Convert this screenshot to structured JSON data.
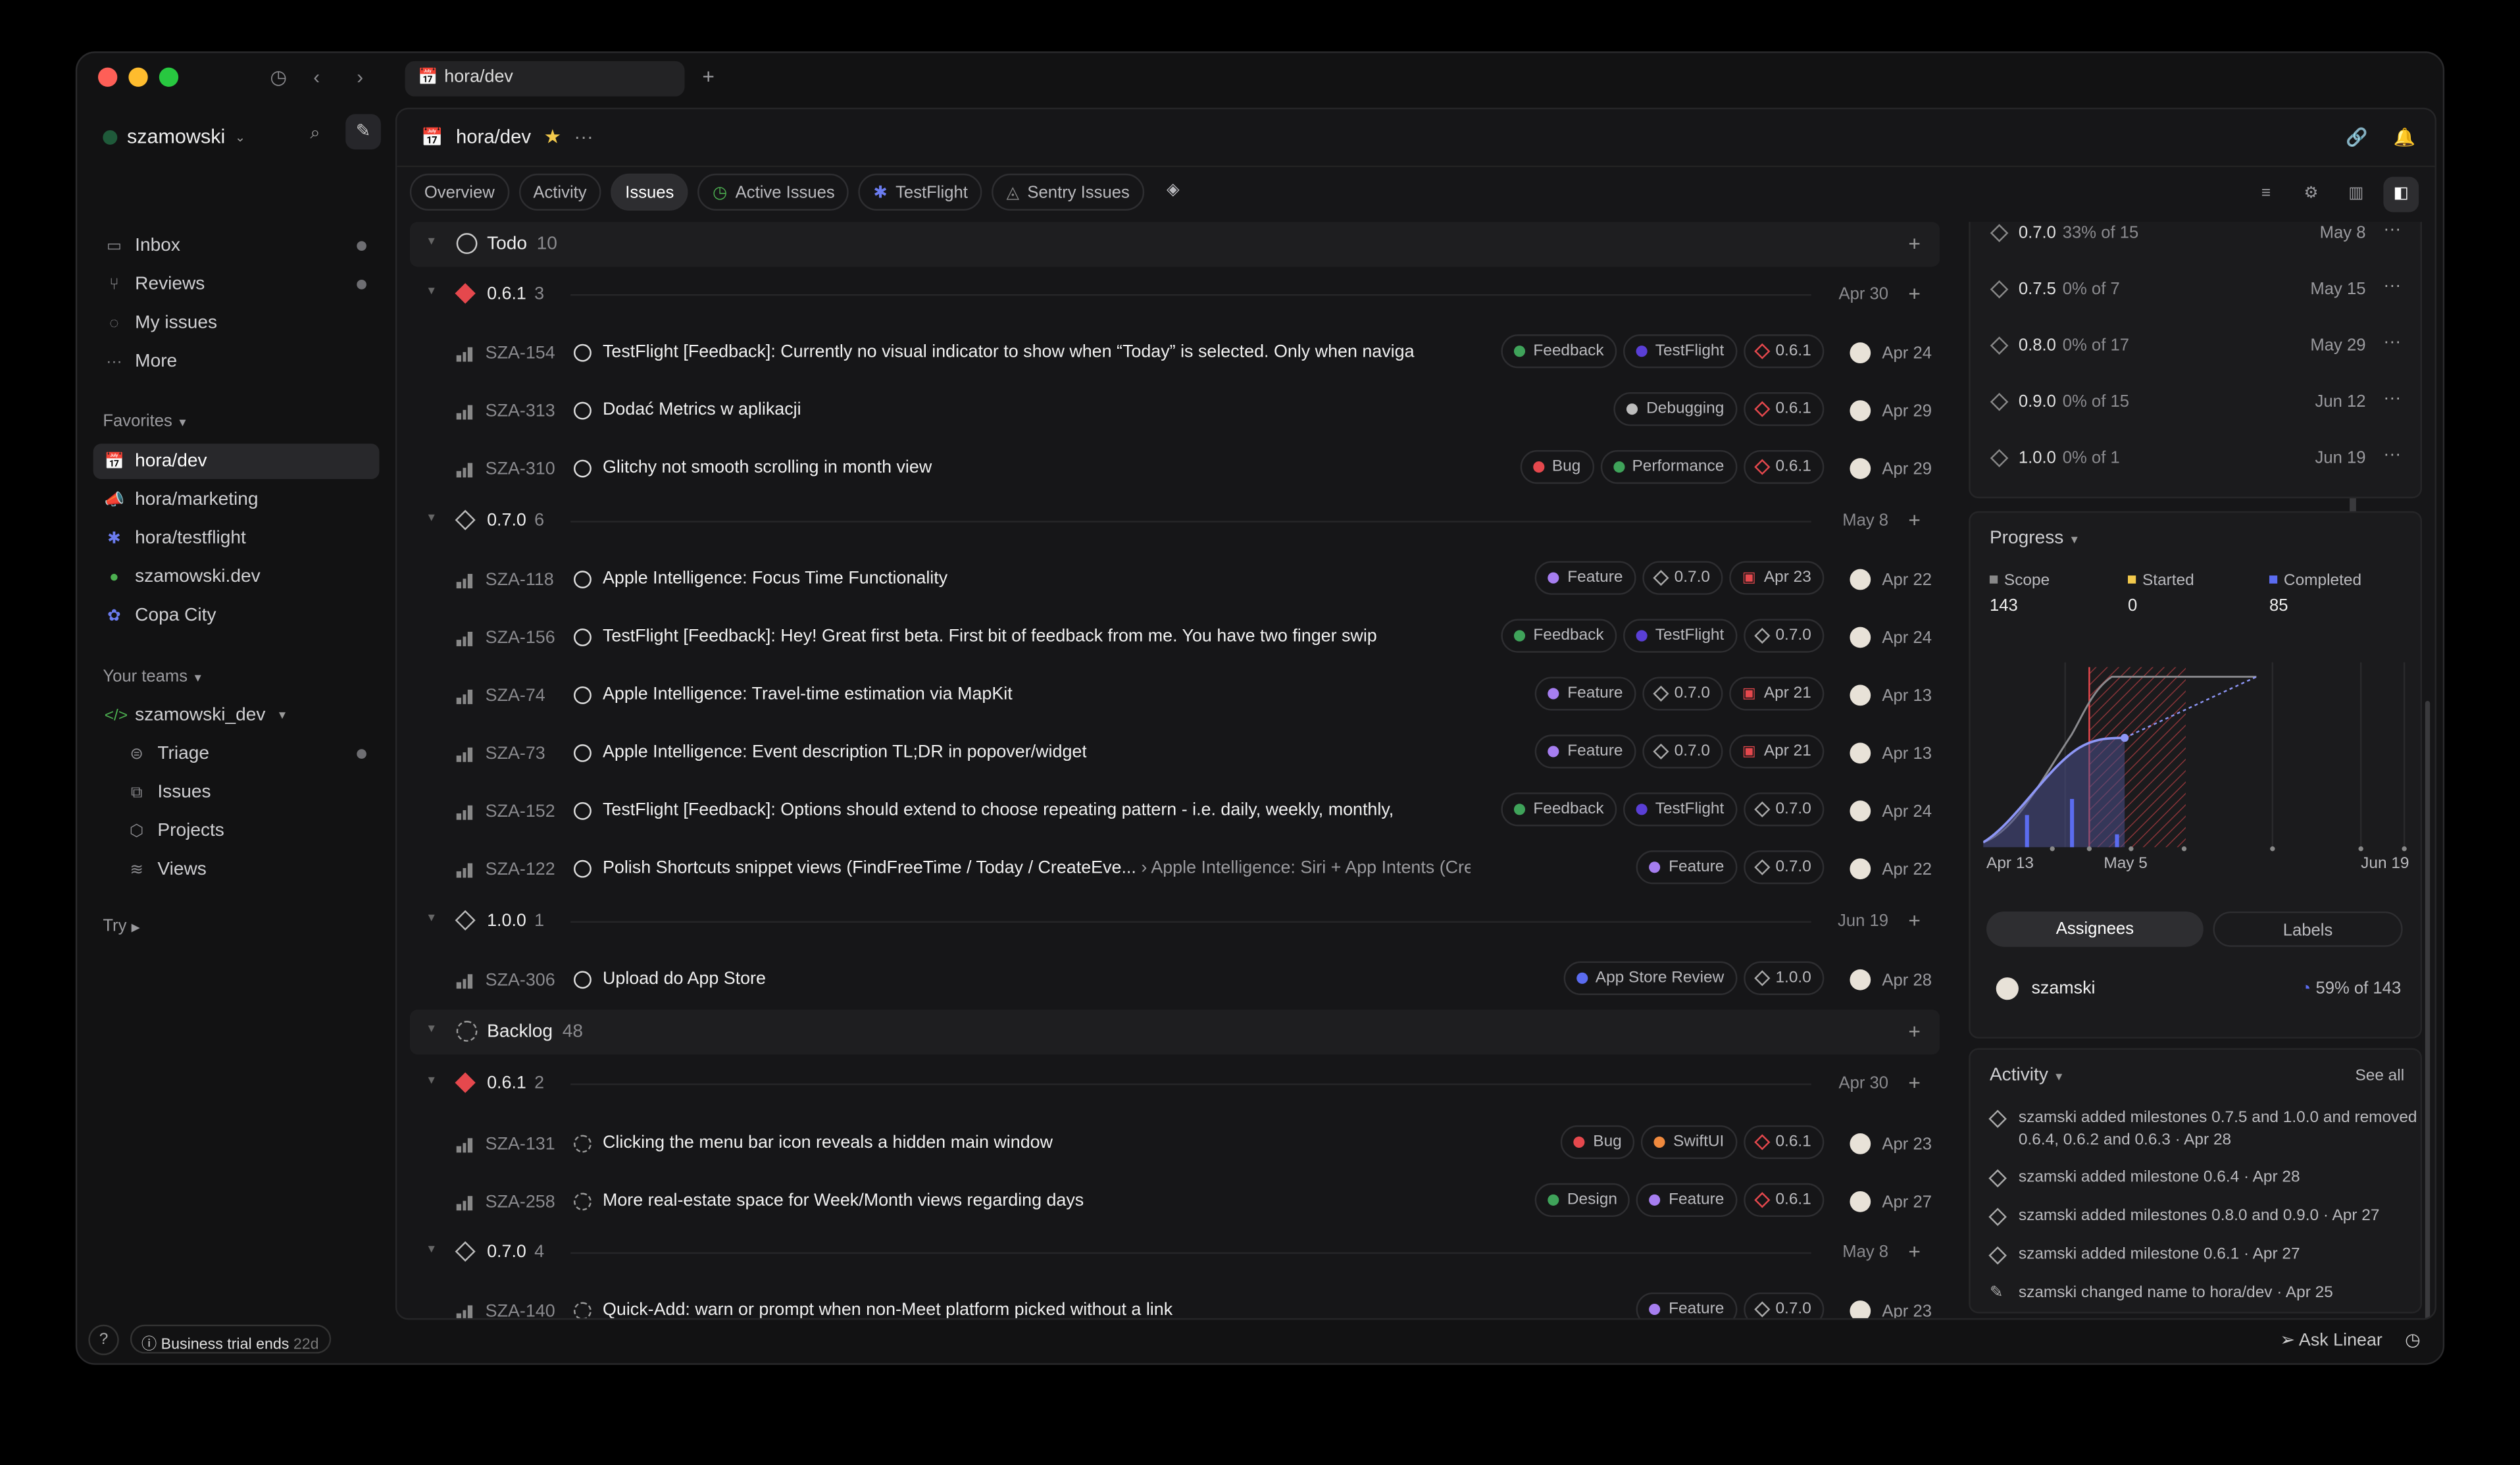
{
  "window": {
    "tab_title": "hora/dev",
    "new_tab": "+"
  },
  "sidebar": {
    "workspace": "szamowski",
    "nav": [
      {
        "label": "Inbox"
      },
      {
        "label": "Reviews"
      },
      {
        "label": "My issues"
      },
      {
        "label": "More"
      }
    ],
    "favorites_label": "Favorites",
    "favorites": [
      {
        "label": "hora/dev"
      },
      {
        "label": "hora/marketing"
      },
      {
        "label": "hora/testflight"
      },
      {
        "label": "szamowski.dev"
      },
      {
        "label": "Copa City"
      }
    ],
    "teams_label": "Your teams",
    "team": "szamowski_dev",
    "team_items": [
      {
        "label": "Triage"
      },
      {
        "label": "Issues"
      },
      {
        "label": "Projects"
      },
      {
        "label": "Views"
      }
    ],
    "try_label": "Try",
    "help": "?",
    "trial": "Business trial ends",
    "trial_days": "22d"
  },
  "header": {
    "title": "hora/dev",
    "more": "···"
  },
  "views": [
    {
      "label": "Overview"
    },
    {
      "label": "Activity"
    },
    {
      "label": "Issues"
    },
    {
      "label": "Active Issues"
    },
    {
      "label": "TestFlight"
    },
    {
      "label": "Sentry Issues"
    }
  ],
  "groups": [
    {
      "name": "Todo",
      "count": "10"
    },
    {
      "name": "Backlog",
      "count": "48"
    }
  ],
  "milestones": [
    {
      "name": "0.6.1",
      "count": "3",
      "date": "Apr 30"
    },
    {
      "name": "0.7.0",
      "count": "6",
      "date": "May 8"
    },
    {
      "name": "1.0.0",
      "count": "1",
      "date": "Jun 19"
    },
    {
      "name": "0.6.1",
      "count": "2",
      "date": "Apr 30"
    },
    {
      "name": "0.7.0",
      "count": "4",
      "date": "May 8"
    }
  ],
  "issues": [
    {
      "id": "SZA-154",
      "title": "TestFlight [Feedback]: Currently no visual indicator to show when “Today” is selected. Only when naviga",
      "labels": [
        "Feedback",
        "TestFlight"
      ],
      "ms": "0.6.1",
      "date": "Apr 24"
    },
    {
      "id": "SZA-313",
      "title": "Dodać Metrics w aplikacji",
      "labels": [
        "Debugging"
      ],
      "ms": "0.6.1",
      "date": "Apr 29"
    },
    {
      "id": "SZA-310",
      "title": "Glitchy not smooth scrolling in month view",
      "labels": [
        "Bug",
        "Performance"
      ],
      "ms": "0.6.1",
      "date": "Apr 29"
    },
    {
      "id": "SZA-118",
      "title": "Apple Intelligence: Focus Time Functionality",
      "labels": [
        "Feature"
      ],
      "ms": "0.7.0",
      "due": "Apr 23",
      "date": "Apr 22"
    },
    {
      "id": "SZA-156",
      "title": "TestFlight [Feedback]: Hey! Great first beta. First bit of feedback from me. You have two finger swip",
      "labels": [
        "Feedback",
        "TestFlight"
      ],
      "ms": "0.7.0",
      "date": "Apr 24"
    },
    {
      "id": "SZA-74",
      "title": "Apple Intelligence: Travel-time estimation via MapKit",
      "labels": [
        "Feature"
      ],
      "ms": "0.7.0",
      "due": "Apr 21",
      "date": "Apr 13"
    },
    {
      "id": "SZA-73",
      "title": "Apple Intelligence: Event description TL;DR in popover/widget",
      "labels": [
        "Feature"
      ],
      "ms": "0.7.0",
      "due": "Apr 21",
      "date": "Apr 13"
    },
    {
      "id": "SZA-152",
      "title": "TestFlight [Feedback]: Options should extend to choose repeating pattern - i.e. daily, weekly, monthly,",
      "labels": [
        "Feedback",
        "TestFlight"
      ],
      "ms": "0.7.0",
      "date": "Apr 24"
    },
    {
      "id": "SZA-122",
      "title": "Polish Shortcuts snippet views (FindFreeTime / Today / CreateEve...",
      "parent": "Apple Intelligence: Siri + App Intents (CreateEvent, ...",
      "labels": [
        "Feature"
      ],
      "ms": "0.7.0",
      "date": "Apr 22"
    },
    {
      "id": "SZA-306",
      "title": "Upload do App Store",
      "labels": [
        "App Store Review"
      ],
      "ms": "1.0.0",
      "date": "Apr 28"
    },
    {
      "id": "SZA-131",
      "title": "Clicking the menu bar icon reveals a hidden main window",
      "labels": [
        "Bug",
        "SwiftUI"
      ],
      "ms": "0.6.1",
      "date": "Apr 23"
    },
    {
      "id": "SZA-258",
      "title": "More real-estate space for Week/Month views regarding days",
      "labels": [
        "Design",
        "Feature"
      ],
      "ms": "0.6.1",
      "date": "Apr 27"
    },
    {
      "id": "SZA-140",
      "title": "Quick-Add: warn or prompt when non-Meet platform picked without a link",
      "labels": [
        "Feature"
      ],
      "ms": "0.7.0",
      "date": "Apr 23"
    }
  ],
  "label_colors": {
    "Feedback": "#3fa35a",
    "TestFlight": "#5a3fd6",
    "Debugging": "#bdbdbd",
    "Bug": "#e5484d",
    "Performance": "#3fa35a",
    "Feature": "#a67ef0",
    "App Store Review": "#5b6cf0",
    "SwiftUI": "#f08a3e",
    "Design": "#3fa35a"
  },
  "panel": {
    "milestones": [
      {
        "name": "0.7.0",
        "pct": "33% of 15",
        "date": "May 8"
      },
      {
        "name": "0.7.5",
        "pct": "0% of 7",
        "date": "May 15"
      },
      {
        "name": "0.8.0",
        "pct": "0% of 17",
        "date": "May 29"
      },
      {
        "name": "0.9.0",
        "pct": "0% of 15",
        "date": "Jun 12"
      },
      {
        "name": "1.0.0",
        "pct": "0% of 1",
        "date": "Jun 19"
      }
    ],
    "progress_label": "Progress",
    "scope_label": "Scope",
    "scope": "143",
    "started_label": "Started",
    "started": "0",
    "completed_label": "Completed",
    "completed": "85",
    "axis": [
      "Apr 13",
      "May 5",
      "Jun 19"
    ],
    "assignees_tab": "Assignees",
    "labels_tab": "Labels",
    "assignee": "szamski",
    "assignee_pct": "59% of 143",
    "activity_label": "Activity",
    "see_all": "See all",
    "activity": [
      "szamski added milestones 0.7.5 and 1.0.0 and removed 0.6.4, 0.6.2 and 0.6.3 · Apr 28",
      "szamski added milestone 0.6.4 · Apr 28",
      "szamski added milestones 0.8.0 and 0.9.0 · Apr 27",
      "szamski added milestone 0.6.1 · Apr 27",
      "szamski changed name to hora/dev · Apr 25"
    ],
    "ask": "Ask Linear"
  },
  "colors": {
    "accent": "#5b6cf0",
    "red": "#e5484d",
    "star": "#f2c94c"
  }
}
